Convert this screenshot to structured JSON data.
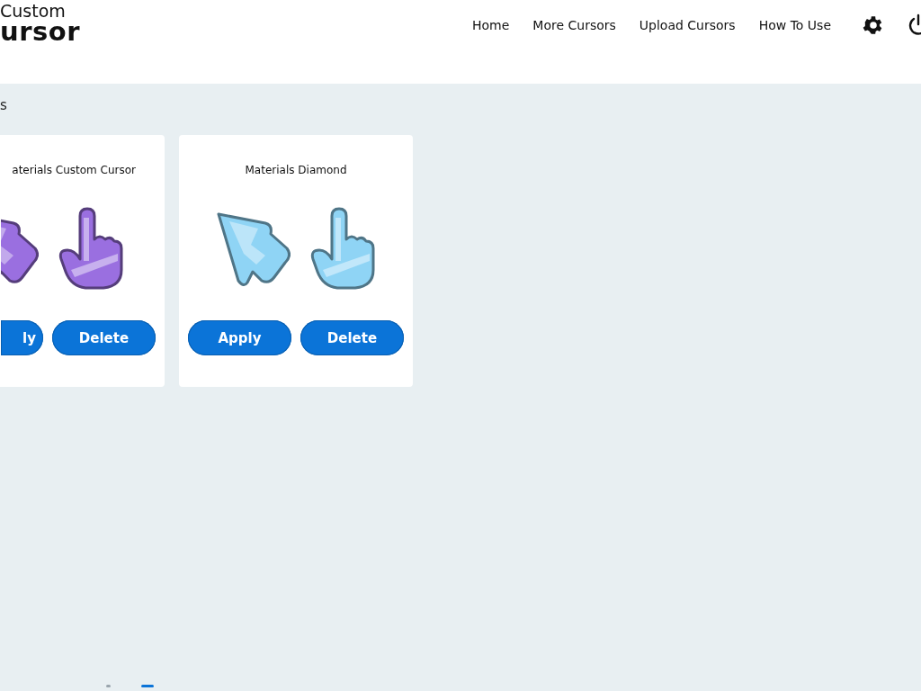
{
  "logo": {
    "line_1": "Custom",
    "line_2": "ursor"
  },
  "nav": [
    "Home",
    "More Cursors",
    "Upload Cursors",
    "How To Use"
  ],
  "heading": "s",
  "cards": [
    {
      "title": "aterials Custom Cursor",
      "color": "#9a6fe0",
      "cut_off": true,
      "buttons": [
        "ly",
        "Delete"
      ]
    },
    {
      "title": "Materials Diamond",
      "color": "#8fd4f5",
      "cut_off": false,
      "buttons": [
        "Apply",
        "Delete"
      ]
    }
  ],
  "pager": [
    {
      "selected": false
    },
    {
      "selected": true
    }
  ]
}
